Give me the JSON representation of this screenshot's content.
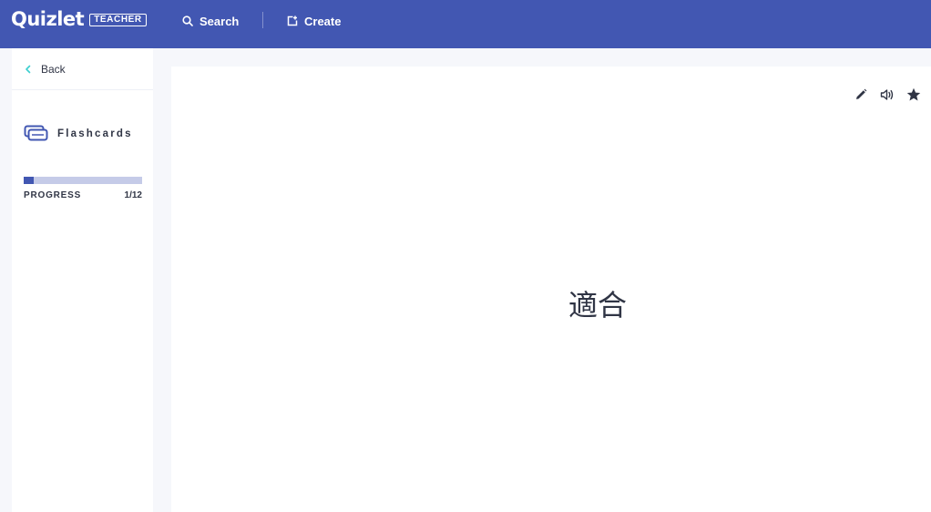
{
  "header": {
    "logo": "Quizlet",
    "badge": "TEACHER",
    "nav": {
      "search_label": "Search",
      "create_label": "Create"
    }
  },
  "sidebar": {
    "back_label": "Back",
    "mode_label": "Flashcards",
    "progress": {
      "label": "PROGRESS",
      "current": 1,
      "total": 12,
      "count_text": "1/12"
    }
  },
  "card": {
    "term": "適合",
    "tools": [
      "pencil-icon",
      "speaker-icon",
      "star-icon"
    ]
  },
  "colors": {
    "brand": "#4257b2",
    "progress_track": "#c5cbe8",
    "text": "#303545",
    "back_chevron": "#3ccfcf"
  }
}
